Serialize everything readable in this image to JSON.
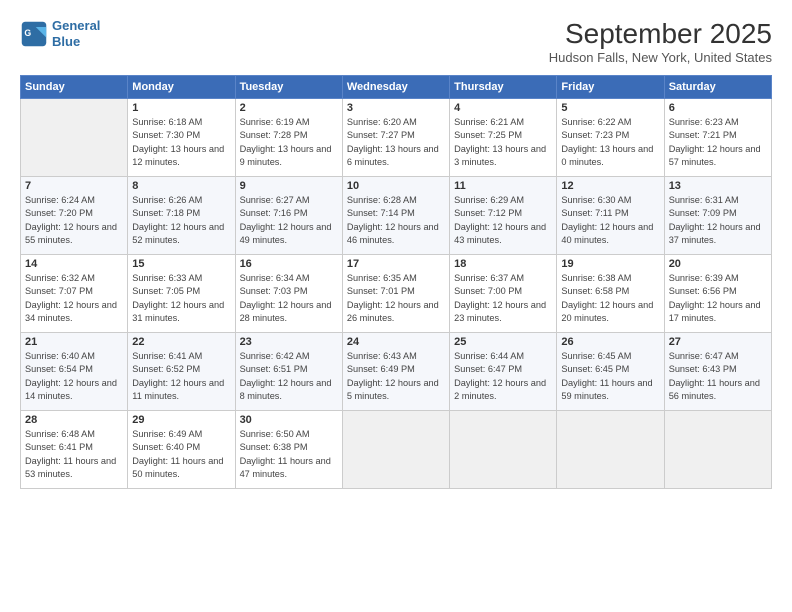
{
  "header": {
    "logo_line1": "General",
    "logo_line2": "Blue",
    "title": "September 2025",
    "subtitle": "Hudson Falls, New York, United States"
  },
  "days_of_week": [
    "Sunday",
    "Monday",
    "Tuesday",
    "Wednesday",
    "Thursday",
    "Friday",
    "Saturday"
  ],
  "weeks": [
    [
      {
        "day": "",
        "sunrise": "",
        "sunset": "",
        "daylight": ""
      },
      {
        "day": "1",
        "sunrise": "Sunrise: 6:18 AM",
        "sunset": "Sunset: 7:30 PM",
        "daylight": "Daylight: 13 hours and 12 minutes."
      },
      {
        "day": "2",
        "sunrise": "Sunrise: 6:19 AM",
        "sunset": "Sunset: 7:28 PM",
        "daylight": "Daylight: 13 hours and 9 minutes."
      },
      {
        "day": "3",
        "sunrise": "Sunrise: 6:20 AM",
        "sunset": "Sunset: 7:27 PM",
        "daylight": "Daylight: 13 hours and 6 minutes."
      },
      {
        "day": "4",
        "sunrise": "Sunrise: 6:21 AM",
        "sunset": "Sunset: 7:25 PM",
        "daylight": "Daylight: 13 hours and 3 minutes."
      },
      {
        "day": "5",
        "sunrise": "Sunrise: 6:22 AM",
        "sunset": "Sunset: 7:23 PM",
        "daylight": "Daylight: 13 hours and 0 minutes."
      },
      {
        "day": "6",
        "sunrise": "Sunrise: 6:23 AM",
        "sunset": "Sunset: 7:21 PM",
        "daylight": "Daylight: 12 hours and 57 minutes."
      }
    ],
    [
      {
        "day": "7",
        "sunrise": "Sunrise: 6:24 AM",
        "sunset": "Sunset: 7:20 PM",
        "daylight": "Daylight: 12 hours and 55 minutes."
      },
      {
        "day": "8",
        "sunrise": "Sunrise: 6:26 AM",
        "sunset": "Sunset: 7:18 PM",
        "daylight": "Daylight: 12 hours and 52 minutes."
      },
      {
        "day": "9",
        "sunrise": "Sunrise: 6:27 AM",
        "sunset": "Sunset: 7:16 PM",
        "daylight": "Daylight: 12 hours and 49 minutes."
      },
      {
        "day": "10",
        "sunrise": "Sunrise: 6:28 AM",
        "sunset": "Sunset: 7:14 PM",
        "daylight": "Daylight: 12 hours and 46 minutes."
      },
      {
        "day": "11",
        "sunrise": "Sunrise: 6:29 AM",
        "sunset": "Sunset: 7:12 PM",
        "daylight": "Daylight: 12 hours and 43 minutes."
      },
      {
        "day": "12",
        "sunrise": "Sunrise: 6:30 AM",
        "sunset": "Sunset: 7:11 PM",
        "daylight": "Daylight: 12 hours and 40 minutes."
      },
      {
        "day": "13",
        "sunrise": "Sunrise: 6:31 AM",
        "sunset": "Sunset: 7:09 PM",
        "daylight": "Daylight: 12 hours and 37 minutes."
      }
    ],
    [
      {
        "day": "14",
        "sunrise": "Sunrise: 6:32 AM",
        "sunset": "Sunset: 7:07 PM",
        "daylight": "Daylight: 12 hours and 34 minutes."
      },
      {
        "day": "15",
        "sunrise": "Sunrise: 6:33 AM",
        "sunset": "Sunset: 7:05 PM",
        "daylight": "Daylight: 12 hours and 31 minutes."
      },
      {
        "day": "16",
        "sunrise": "Sunrise: 6:34 AM",
        "sunset": "Sunset: 7:03 PM",
        "daylight": "Daylight: 12 hours and 28 minutes."
      },
      {
        "day": "17",
        "sunrise": "Sunrise: 6:35 AM",
        "sunset": "Sunset: 7:01 PM",
        "daylight": "Daylight: 12 hours and 26 minutes."
      },
      {
        "day": "18",
        "sunrise": "Sunrise: 6:37 AM",
        "sunset": "Sunset: 7:00 PM",
        "daylight": "Daylight: 12 hours and 23 minutes."
      },
      {
        "day": "19",
        "sunrise": "Sunrise: 6:38 AM",
        "sunset": "Sunset: 6:58 PM",
        "daylight": "Daylight: 12 hours and 20 minutes."
      },
      {
        "day": "20",
        "sunrise": "Sunrise: 6:39 AM",
        "sunset": "Sunset: 6:56 PM",
        "daylight": "Daylight: 12 hours and 17 minutes."
      }
    ],
    [
      {
        "day": "21",
        "sunrise": "Sunrise: 6:40 AM",
        "sunset": "Sunset: 6:54 PM",
        "daylight": "Daylight: 12 hours and 14 minutes."
      },
      {
        "day": "22",
        "sunrise": "Sunrise: 6:41 AM",
        "sunset": "Sunset: 6:52 PM",
        "daylight": "Daylight: 12 hours and 11 minutes."
      },
      {
        "day": "23",
        "sunrise": "Sunrise: 6:42 AM",
        "sunset": "Sunset: 6:51 PM",
        "daylight": "Daylight: 12 hours and 8 minutes."
      },
      {
        "day": "24",
        "sunrise": "Sunrise: 6:43 AM",
        "sunset": "Sunset: 6:49 PM",
        "daylight": "Daylight: 12 hours and 5 minutes."
      },
      {
        "day": "25",
        "sunrise": "Sunrise: 6:44 AM",
        "sunset": "Sunset: 6:47 PM",
        "daylight": "Daylight: 12 hours and 2 minutes."
      },
      {
        "day": "26",
        "sunrise": "Sunrise: 6:45 AM",
        "sunset": "Sunset: 6:45 PM",
        "daylight": "Daylight: 11 hours and 59 minutes."
      },
      {
        "day": "27",
        "sunrise": "Sunrise: 6:47 AM",
        "sunset": "Sunset: 6:43 PM",
        "daylight": "Daylight: 11 hours and 56 minutes."
      }
    ],
    [
      {
        "day": "28",
        "sunrise": "Sunrise: 6:48 AM",
        "sunset": "Sunset: 6:41 PM",
        "daylight": "Daylight: 11 hours and 53 minutes."
      },
      {
        "day": "29",
        "sunrise": "Sunrise: 6:49 AM",
        "sunset": "Sunset: 6:40 PM",
        "daylight": "Daylight: 11 hours and 50 minutes."
      },
      {
        "day": "30",
        "sunrise": "Sunrise: 6:50 AM",
        "sunset": "Sunset: 6:38 PM",
        "daylight": "Daylight: 11 hours and 47 minutes."
      },
      {
        "day": "",
        "sunrise": "",
        "sunset": "",
        "daylight": ""
      },
      {
        "day": "",
        "sunrise": "",
        "sunset": "",
        "daylight": ""
      },
      {
        "day": "",
        "sunrise": "",
        "sunset": "",
        "daylight": ""
      },
      {
        "day": "",
        "sunrise": "",
        "sunset": "",
        "daylight": ""
      }
    ]
  ]
}
